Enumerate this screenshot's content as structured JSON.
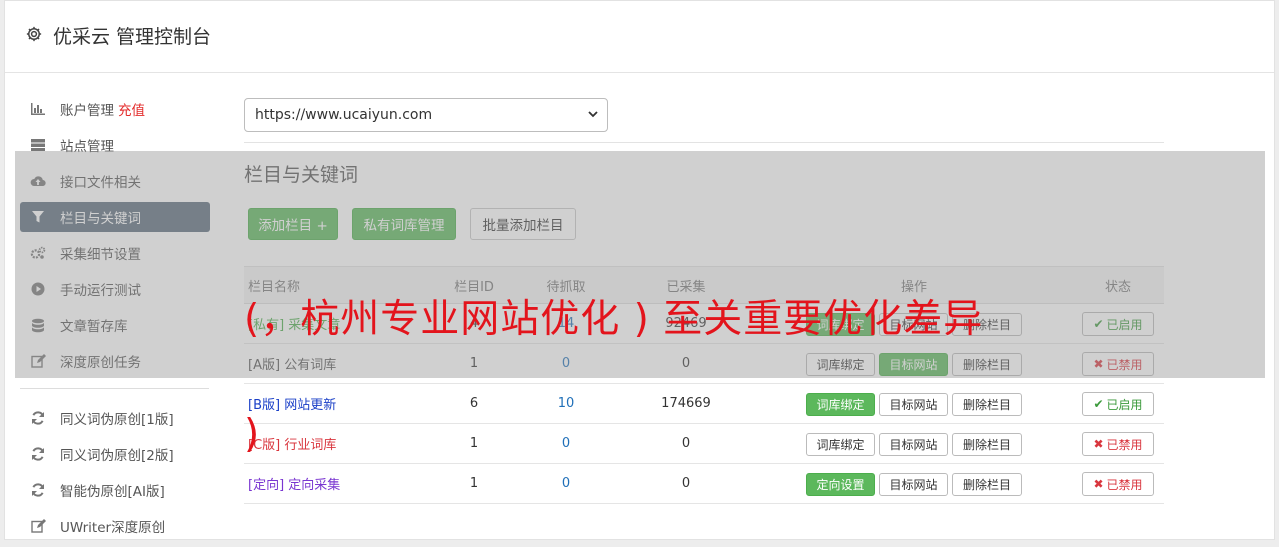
{
  "header": {
    "title": "优采云 管理控制台",
    "icon": "gear-icon"
  },
  "sidebar": {
    "items": [
      {
        "label": "账户管理",
        "badge": "充值",
        "icon": "bar-chart-icon"
      },
      {
        "label": "站点管理",
        "icon": "server-icon"
      },
      {
        "label": "接口文件相关",
        "icon": "cloud-upload-icon"
      },
      {
        "label": "栏目与关键词",
        "icon": "filter-icon",
        "active": true
      },
      {
        "label": "采集细节设置",
        "icon": "cogs-icon"
      },
      {
        "label": "手动运行测试",
        "icon": "play-circle-icon"
      },
      {
        "label": "文章暂存库",
        "icon": "database-icon"
      },
      {
        "label": "深度原创任务",
        "icon": "edit-icon"
      }
    ],
    "rewrite_items": [
      {
        "label": "同义词伪原创[1版]",
        "icon": "refresh-icon"
      },
      {
        "label": "同义词伪原创[2版]",
        "icon": "refresh-icon"
      },
      {
        "label": "智能伪原创[AI版]",
        "icon": "refresh-icon"
      },
      {
        "label": "UWriter深度原创",
        "icon": "edit-icon"
      }
    ]
  },
  "site_select": {
    "value": "https://www.ucaiyun.com"
  },
  "section_title": "栏目与关键词",
  "toolbar": {
    "add_column": "添加栏目 +",
    "private_lib": "私有词库管理",
    "batch_add": "批量添加栏目"
  },
  "table": {
    "headers": {
      "name": "栏目名称",
      "id": "栏目ID",
      "todo": "待抓取",
      "done": "已采集",
      "ops": "操作",
      "status": "状态"
    },
    "rows": [
      {
        "tag": "[私有]",
        "name": "采集文章",
        "count": "4",
        "todo": "14",
        "done": "92469",
        "op1": "词库绑定",
        "op1_green": true,
        "op2": "目标网站",
        "op2_green": false,
        "op3": "删除栏目",
        "status": "已启用",
        "enabled": true
      },
      {
        "tag": "[A版]",
        "name": "公有词库",
        "count": "1",
        "todo": "0",
        "done": "0",
        "op1": "词库绑定",
        "op1_green": false,
        "op2": "目标网站",
        "op2_green": true,
        "op3": "删除栏目",
        "status": "已禁用",
        "enabled": false
      },
      {
        "tag": "[B版]",
        "name": "网站更新",
        "count": "6",
        "todo": "10",
        "done": "174669",
        "op1": "词库绑定",
        "op1_green": true,
        "op2": "目标网站",
        "op2_green": false,
        "op3": "删除栏目",
        "status": "已启用",
        "enabled": true
      },
      {
        "tag": "[C版]",
        "name": "行业词库",
        "count": "1",
        "todo": "0",
        "done": "0",
        "op1": "词库绑定",
        "op1_green": false,
        "op2": "目标网站",
        "op2_green": false,
        "op3": "删除栏目",
        "status": "已禁用",
        "enabled": false
      },
      {
        "tag": "[定向]",
        "name": "定向采集",
        "count": "1",
        "todo": "0",
        "done": "0",
        "op1": "定向设置",
        "op1_green": true,
        "op2": "目标网站",
        "op2_green": false,
        "op3": "删除栏目",
        "status": "已禁用",
        "enabled": false
      }
    ]
  },
  "watermark": {
    "line1": "(，杭州专业网站优化 ) 至关重要优化差异",
    "line2": ")"
  },
  "colors": {
    "green": "#5cb85c",
    "active_nav": "#5b6c7d",
    "watermark": "#e3141c",
    "recharge": "#e32a2a"
  }
}
